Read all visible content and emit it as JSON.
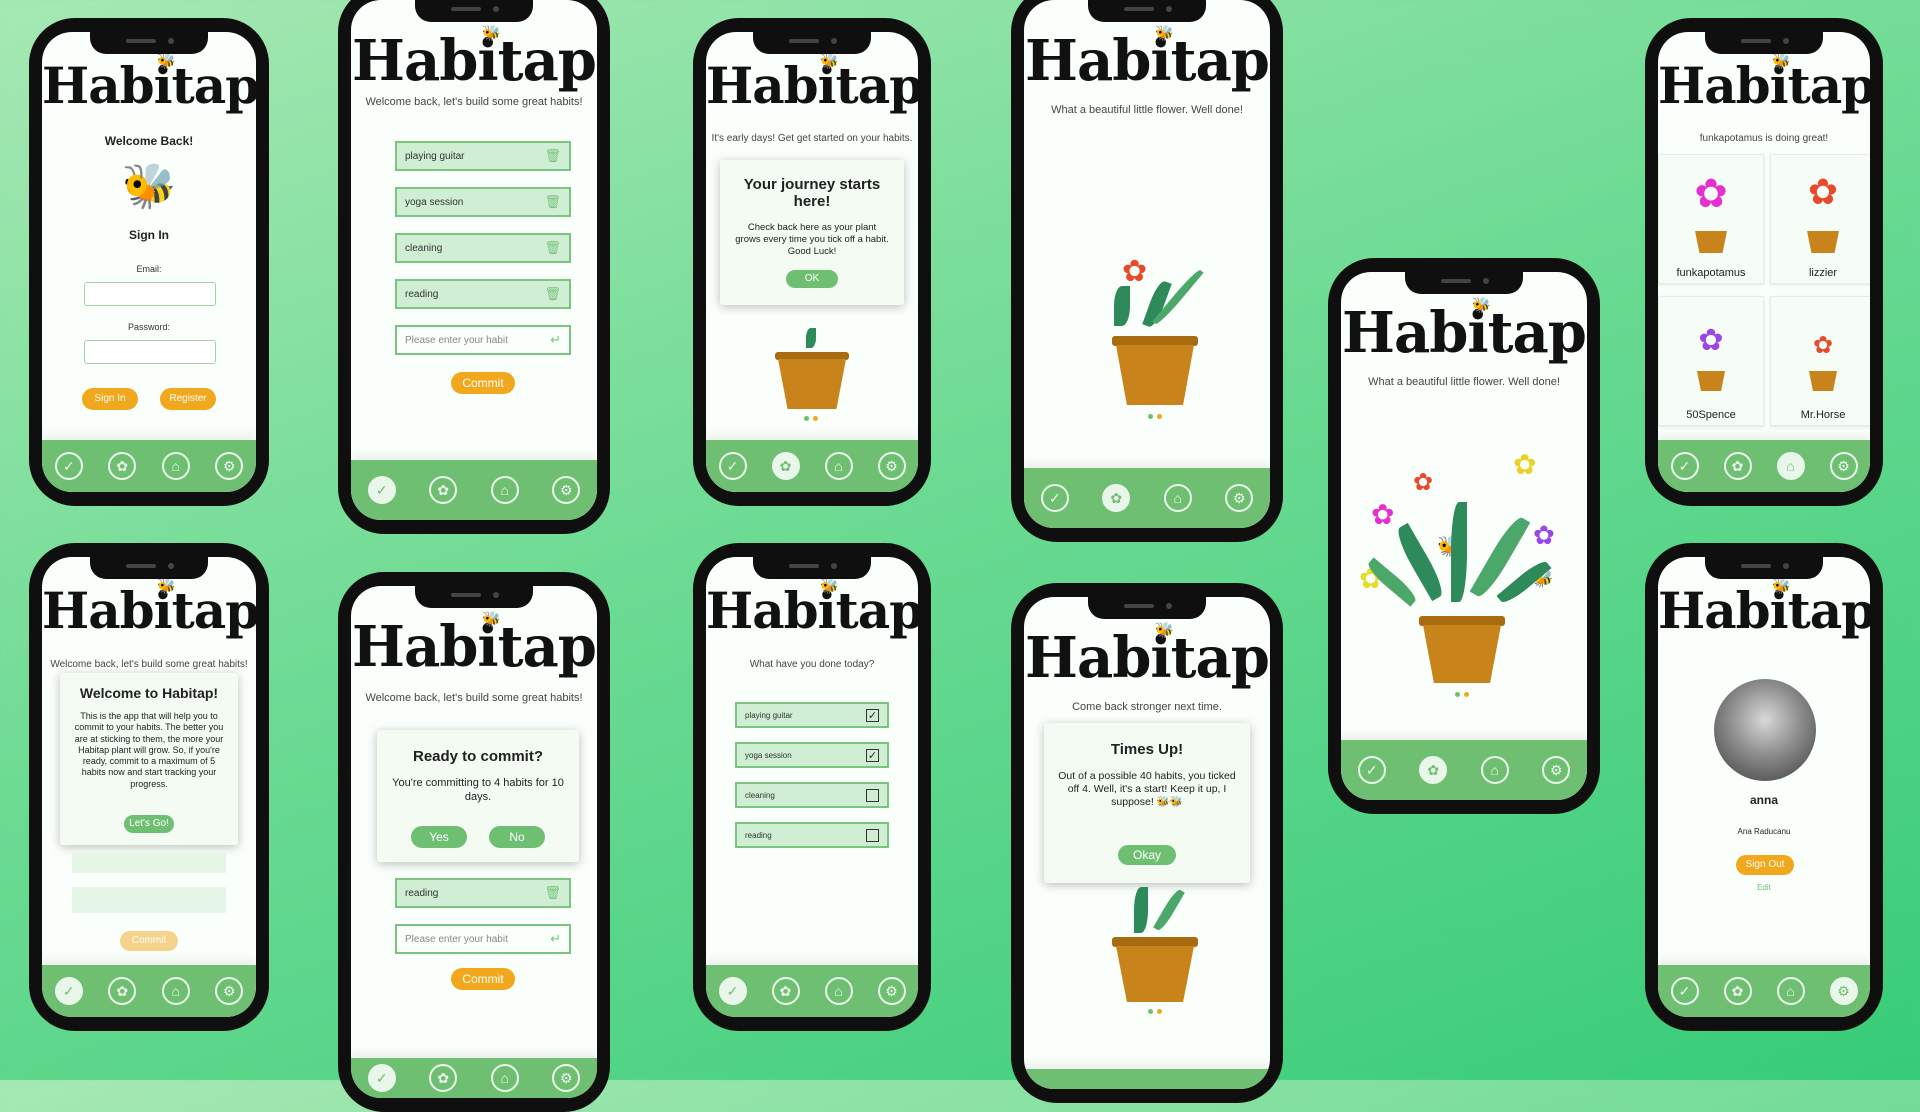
{
  "app_name": "Habitap",
  "nav_icons": [
    "check-icon",
    "flower-icon",
    "hive-icon",
    "gear-icon"
  ],
  "colors": {
    "accent": "#f2a81d",
    "primary_green": "#6fbf73",
    "field_green": "#cfeed3",
    "background": "#5fd88a"
  },
  "login": {
    "welcome": "Welcome Back!",
    "sign_in_title": "Sign In",
    "email_label": "Email:",
    "password_label": "Password:",
    "sign_in_button": "Sign In",
    "register_button": "Register"
  },
  "habits_edit": {
    "subtitle": "Welcome back, let's build some great habits!",
    "habits": [
      "playing guitar",
      "yoga session",
      "cleaning",
      "reading"
    ],
    "input_placeholder": "Please enter your habit",
    "commit_button": "Commit"
  },
  "journey": {
    "subtitle": "It's early days! Get get started on your habits.",
    "modal_title": "Your journey starts here!",
    "modal_text": "Check back here as your plant grows every time you tick off a habit. Good Luck!",
    "ok_button": "OK"
  },
  "flower_small": {
    "subtitle": "What a beautiful little flower. Well done!"
  },
  "flower_big": {
    "subtitle": "What a beautiful little flower. Well done!"
  },
  "community": {
    "subtitle": "funkapotamus is doing great!",
    "users": [
      "funkapotamus",
      "lizzier",
      "50Spence",
      "Mr.Horse"
    ]
  },
  "welcome_modal": {
    "subtitle": "Welcome back, let's build some great habits!",
    "title": "Welcome to Habitap!",
    "text": "This is the app that will help you to commit to your habits. The better you are at sticking to them, the more your Habitap plant will grow. So, if you're ready, commit to a maximum of 5 habits now and start tracking your progress.",
    "button": "Let's Go!",
    "commit_button": "Commit"
  },
  "commit_modal": {
    "subtitle": "Welcome back, let's build some great habits!",
    "title": "Ready to commit?",
    "text": "You're committing to 4 habits for 10 days.",
    "yes": "Yes",
    "no": "No",
    "habit": "reading",
    "input_placeholder": "Please enter your habit",
    "commit_button": "Commit"
  },
  "today": {
    "subtitle": "What have you done today?",
    "habits": [
      {
        "name": "playing guitar",
        "checked": true
      },
      {
        "name": "yoga session",
        "checked": true
      },
      {
        "name": "cleaning",
        "checked": false
      },
      {
        "name": "reading",
        "checked": false
      }
    ]
  },
  "timesup": {
    "subtitle": "Come back stronger next time.",
    "title": "Times Up!",
    "text": "Out of a possible 40 habits, you ticked off 4. Well, it's a start! Keep it up, I suppose! 🐝🐝",
    "button": "Okay"
  },
  "profile": {
    "username": "anna",
    "full_name": "Ana Raducanu",
    "sign_out": "Sign Out",
    "edit": "Edit"
  }
}
